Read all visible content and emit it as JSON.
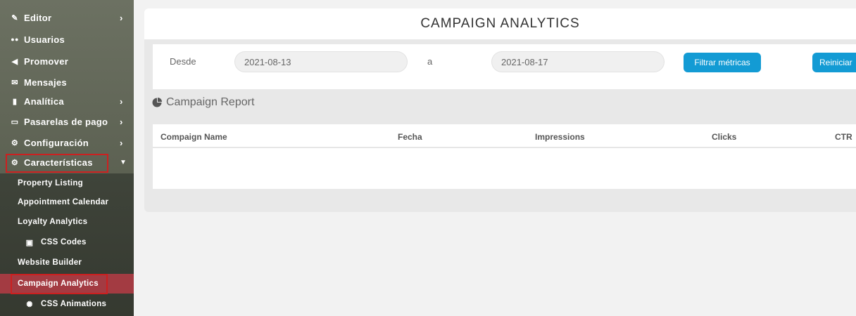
{
  "sidebar": {
    "items": [
      {
        "label": "Editor",
        "icon": "pencil-icon",
        "glyph": "✎"
      },
      {
        "label": "Usuarios",
        "icon": "users-icon",
        "glyph": "👥"
      },
      {
        "label": "Promover",
        "icon": "bullhorn-icon",
        "glyph": "📣"
      },
      {
        "label": "Mensajes",
        "icon": "envelope-icon",
        "glyph": "✉"
      },
      {
        "label": "Analítica",
        "icon": "bar-chart-icon",
        "glyph": "📊"
      },
      {
        "label": "Pasarelas de pago",
        "icon": "credit-card-icon",
        "glyph": "▭"
      },
      {
        "label": "Configuración",
        "icon": "settings-icon",
        "glyph": "⚙"
      },
      {
        "label": "Características",
        "icon": "cogs-icon",
        "glyph": "⚙"
      }
    ],
    "submenu": [
      {
        "label": "Property Listing"
      },
      {
        "label": "Appointment Calendar"
      },
      {
        "label": "Loyalty Analytics"
      },
      {
        "label": "CSS Codes",
        "icon": "code-file-icon",
        "glyph": "▣"
      },
      {
        "label": "Website Builder"
      },
      {
        "label": "Campaign Analytics"
      },
      {
        "label": "CSS Animations",
        "icon": "spinner-icon",
        "glyph": "✺"
      }
    ]
  },
  "main": {
    "title": "CAMPAIGN ANALYTICS",
    "filter": {
      "from_label": "Desde",
      "from_value": "2021-08-13",
      "to_label": "a",
      "to_value": "2021-08-17",
      "filter_button": "Filtrar métricas",
      "reset_button": "Reiniciar"
    },
    "report_title": "Campaign Report",
    "table": {
      "columns": [
        "Compaign Name",
        "Fecha",
        "Impressions",
        "Clicks",
        "CTR"
      ]
    }
  },
  "colors": {
    "accent": "#139bd4",
    "active": "#a33b42",
    "highlight": "#cc2020"
  }
}
